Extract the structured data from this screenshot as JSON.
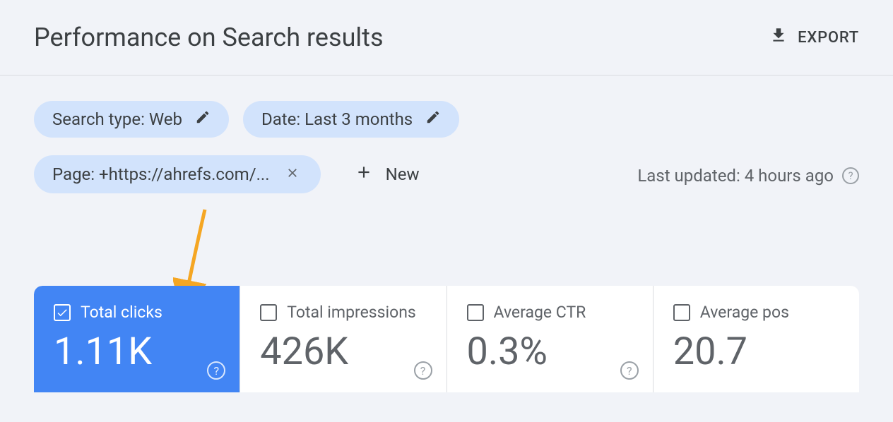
{
  "header": {
    "title": "Performance on Search results",
    "export_label": "EXPORT"
  },
  "filters": {
    "search_type": "Search type: Web",
    "date": "Date: Last 3 months",
    "page": "Page: +https://ahrefs.com/...",
    "new_label": "New"
  },
  "status": {
    "last_updated": "Last updated: 4 hours ago"
  },
  "metrics": {
    "total_clicks": {
      "label": "Total clicks",
      "value": "1.11K"
    },
    "total_impressions": {
      "label": "Total impressions",
      "value": "426K"
    },
    "avg_ctr": {
      "label": "Average CTR",
      "value": "0.3%"
    },
    "avg_position": {
      "label": "Average pos",
      "value": "20.7"
    }
  }
}
